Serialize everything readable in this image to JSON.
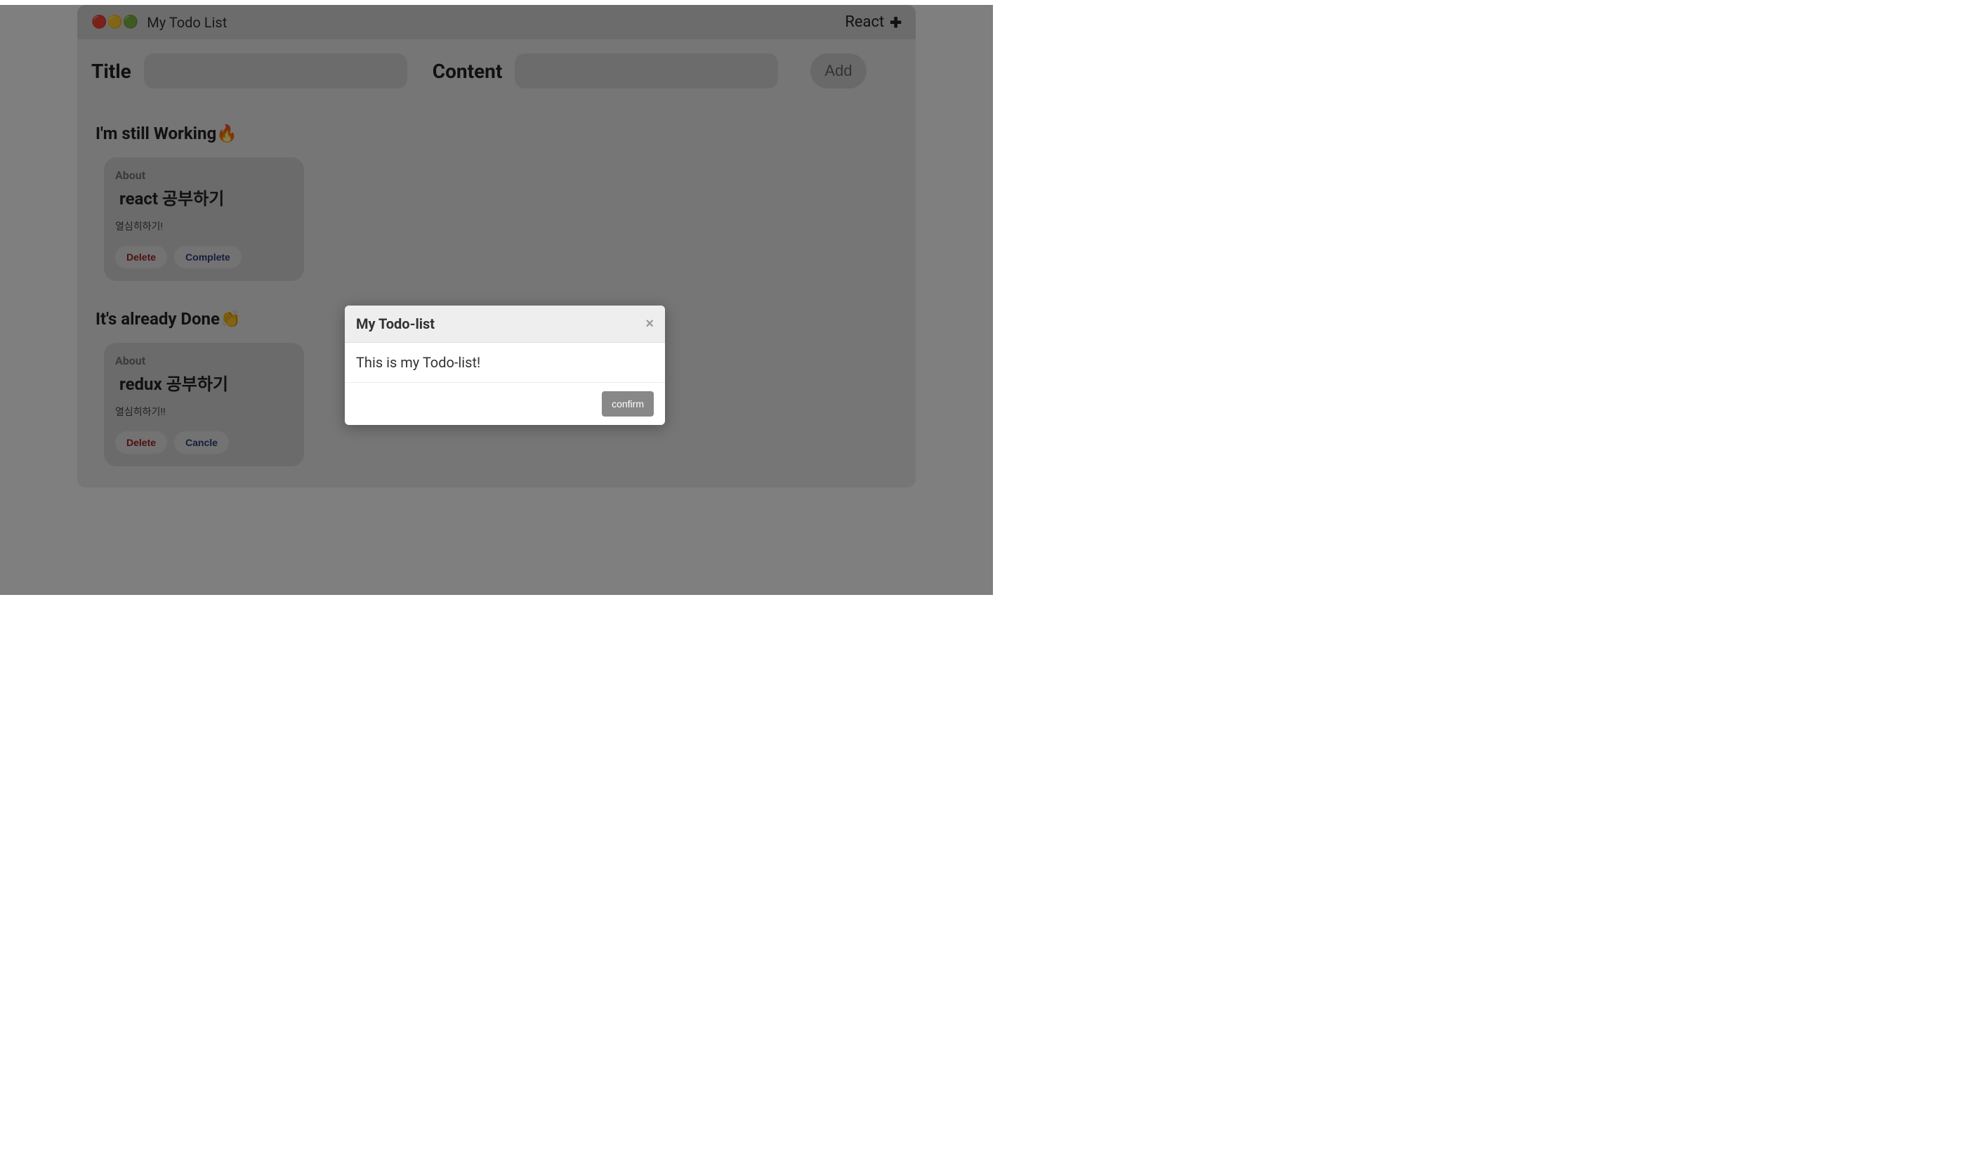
{
  "header": {
    "traffic_lights": "🔴🟡🟢",
    "app_title": "My Todo List",
    "right_label": "React",
    "plus": "✚"
  },
  "form": {
    "title_label": "Title",
    "content_label": "Content",
    "add_button": "Add"
  },
  "sections": {
    "working_heading": "I'm still Working🔥",
    "done_heading": "It's already Done👏"
  },
  "cards": {
    "working": {
      "about": "About",
      "title": "react 공부하기",
      "body": "열심히하기!",
      "delete": "Delete",
      "complete": "Complete"
    },
    "done": {
      "about": "About",
      "title": "redux 공부하기",
      "body": "열심히하기!!",
      "delete": "Delete",
      "cancel": "Cancle"
    }
  },
  "modal": {
    "title": "My Todo-list",
    "body": "This is my Todo-list!",
    "confirm": "confirm",
    "close": "×"
  }
}
